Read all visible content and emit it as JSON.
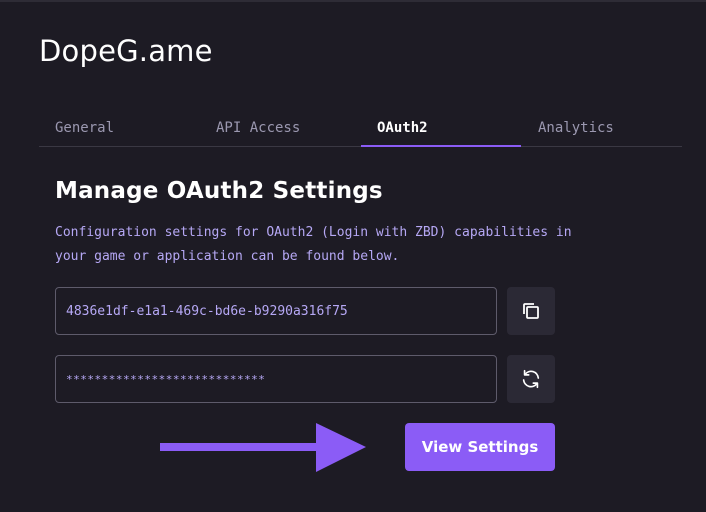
{
  "app": {
    "title": "DopeG.ame"
  },
  "tabs": [
    {
      "label": "General"
    },
    {
      "label": "API Access"
    },
    {
      "label": "OAuth2"
    },
    {
      "label": "Analytics"
    }
  ],
  "active_tab": "OAuth2",
  "section": {
    "title": "Manage OAuth2 Settings",
    "description": "Configuration settings for OAuth2 (Login with ZBD) capabilities in your game or application can be found below."
  },
  "fields": {
    "client_id": "4836e1df-e1a1-469c-bd6e-b9290a316f75",
    "client_secret": "****************************"
  },
  "buttons": {
    "view_settings": "View Settings"
  },
  "icons": {
    "copy": "copy-icon",
    "refresh": "refresh-icon",
    "arrow": "arrow-right-icon"
  },
  "colors": {
    "accent": "#8b5cf6",
    "background": "#1d1b24",
    "muted_text": "#9b98b0",
    "description_text": "#b6a8f5"
  }
}
